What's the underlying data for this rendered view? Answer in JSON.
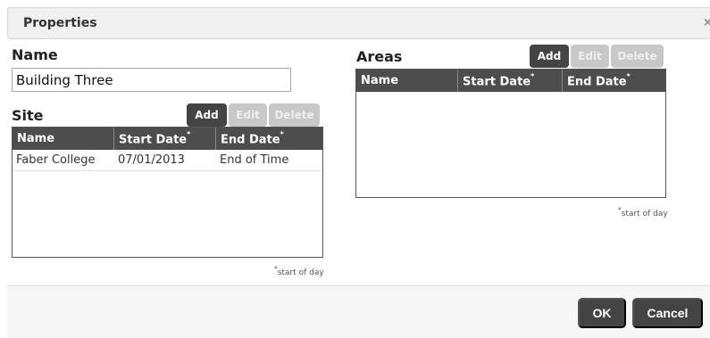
{
  "dialog": {
    "title": "Properties",
    "close_glyph": "×"
  },
  "name_section": {
    "label": "Name",
    "value": "Building Three"
  },
  "site": {
    "label": "Site",
    "buttons": {
      "add": "Add",
      "edit": "Edit",
      "delete": "Delete"
    },
    "columns": [
      "Name",
      "Start Date",
      "End Date"
    ],
    "rows": [
      {
        "name": "Faber College",
        "start": "07/01/2013",
        "end": "End of Time"
      }
    ],
    "note_mark": "*",
    "note": "start of day"
  },
  "areas": {
    "label": "Areas",
    "buttons": {
      "add": "Add",
      "edit": "Edit",
      "delete": "Delete"
    },
    "columns": [
      "Name",
      "Start Date",
      "End Date"
    ],
    "rows": [],
    "note_mark": "*",
    "note": "start of day"
  },
  "footer": {
    "ok": "OK",
    "cancel": "Cancel"
  },
  "colors": {
    "header_bg": "#4d4d4d",
    "button_dark": "#444444",
    "button_disabled": "#c8c8c8"
  }
}
